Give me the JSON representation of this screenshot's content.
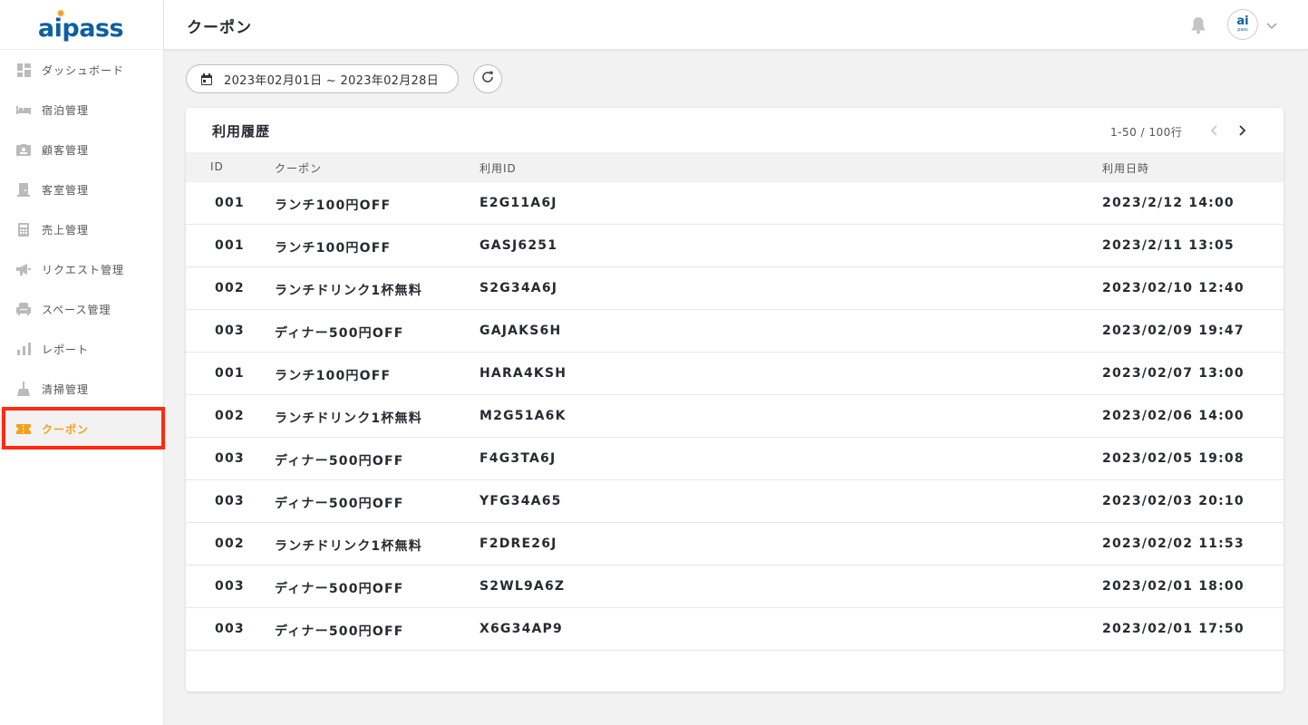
{
  "app": {
    "logo_text": "aipass"
  },
  "header": {
    "title": "クーポン",
    "avatar_text": "ai",
    "avatar_sub": "pass"
  },
  "sidebar": {
    "items": [
      {
        "label": "ダッシュボード",
        "icon": "dashboard-icon"
      },
      {
        "label": "宿泊管理",
        "icon": "bed-icon"
      },
      {
        "label": "顧客管理",
        "icon": "contact-card-icon"
      },
      {
        "label": "客室管理",
        "icon": "door-icon"
      },
      {
        "label": "売上管理",
        "icon": "calculator-icon"
      },
      {
        "label": "リクエスト管理",
        "icon": "megaphone-icon"
      },
      {
        "label": "スペース管理",
        "icon": "armchair-icon"
      },
      {
        "label": "レポート",
        "icon": "bar-chart-icon"
      },
      {
        "label": "清掃管理",
        "icon": "broom-icon"
      },
      {
        "label": "クーポン",
        "icon": "ticket-icon",
        "active": true
      }
    ]
  },
  "filter": {
    "date_range": "2023年02月01日 ~ 2023年02月28日"
  },
  "card": {
    "title": "利用履歴",
    "pager": "1-50 / 100行",
    "columns": [
      "ID",
      "クーポン",
      "利用ID",
      "利用日時"
    ],
    "rows": [
      {
        "id": "001",
        "coupon": "ランチ100円OFF",
        "use_id": "E2G11A6J",
        "datetime": "2023/2/12 14:00"
      },
      {
        "id": "001",
        "coupon": "ランチ100円OFF",
        "use_id": "GASJ6251",
        "datetime": "2023/2/11 13:05"
      },
      {
        "id": "002",
        "coupon": "ランチドリンク1杯無料",
        "use_id": "S2G34A6J",
        "datetime": "2023/02/10 12:40"
      },
      {
        "id": "003",
        "coupon": "ディナー500円OFF",
        "use_id": "GAJAKS6H",
        "datetime": "2023/02/09 19:47"
      },
      {
        "id": "001",
        "coupon": "ランチ100円OFF",
        "use_id": "HARA4KSH",
        "datetime": "2023/02/07 13:00"
      },
      {
        "id": "002",
        "coupon": "ランチドリンク1杯無料",
        "use_id": "M2G51A6K",
        "datetime": "2023/02/06 14:00"
      },
      {
        "id": "003",
        "coupon": "ディナー500円OFF",
        "use_id": "F4G3TA6J",
        "datetime": "2023/02/05 19:08"
      },
      {
        "id": "003",
        "coupon": "ディナー500円OFF",
        "use_id": "YFG34A65",
        "datetime": "2023/02/03 20:10"
      },
      {
        "id": "002",
        "coupon": "ランチドリンク1杯無料",
        "use_id": "F2DRE26J",
        "datetime": "2023/02/02 11:53"
      },
      {
        "id": "003",
        "coupon": "ディナー500円OFF",
        "use_id": "S2WL9A6Z",
        "datetime": "2023/02/01 18:00"
      },
      {
        "id": "003",
        "coupon": "ディナー500円OFF",
        "use_id": "X6G34AP9",
        "datetime": "2023/02/01 17:50"
      }
    ]
  },
  "colors": {
    "accent": "#f5a01a",
    "brand": "#0d5fa3",
    "highlight": "#ff2a0e"
  }
}
